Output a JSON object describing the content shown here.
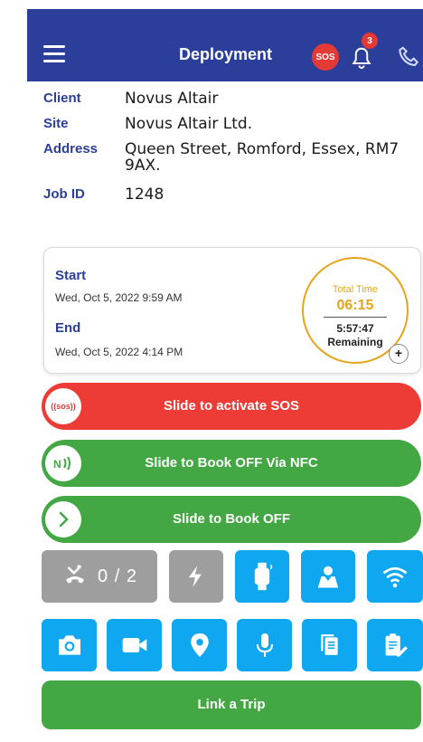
{
  "header": {
    "title": "Deployment",
    "sos_badge": "SOS",
    "notification_count": "3",
    "background": "#2b3f9a"
  },
  "info": {
    "client_label": "Client",
    "client_value": "Novus Altair",
    "site_label": "Site",
    "site_value": "Novus Altair Ltd.",
    "address_label": "Address",
    "address_value": "Queen Street, Romford, Essex, RM7 9AX.",
    "jobid_label": "Job ID",
    "jobid_value": "1248"
  },
  "time": {
    "start_label": "Start",
    "start_value": "Wed, Oct 5, 2022 9:59 AM",
    "end_label": "End",
    "end_value": "Wed, Oct 5, 2022 4:14 PM",
    "total_label": "Total Time",
    "total_value": "06:15",
    "remaining_value": "5:57:47",
    "remaining_label": "Remaining",
    "plus": "+"
  },
  "slides": {
    "sos_label": "Slide to activate SOS",
    "sos_knob": "((sos))",
    "nfc_label": "Slide to Book OFF Via NFC",
    "off_label": "Slide to Book OFF"
  },
  "grid": {
    "call_count": "0 / 2",
    "icons_row1": [
      "missed-call-icon",
      "flash-icon",
      "smartwatch-icon",
      "map-person-icon",
      "wifi-icon"
    ],
    "icons_row2": [
      "camera-icon",
      "video-icon",
      "location-pin-icon",
      "microphone-icon",
      "copy-icon",
      "clipboard-edit-icon"
    ]
  },
  "link_trip": "Link a Trip",
  "colors": {
    "red": "#ed3b35",
    "green": "#43a843",
    "blue_tile": "#0fa7f0",
    "grey_tile": "#9e9e9e",
    "accent": "#e5a51b"
  }
}
